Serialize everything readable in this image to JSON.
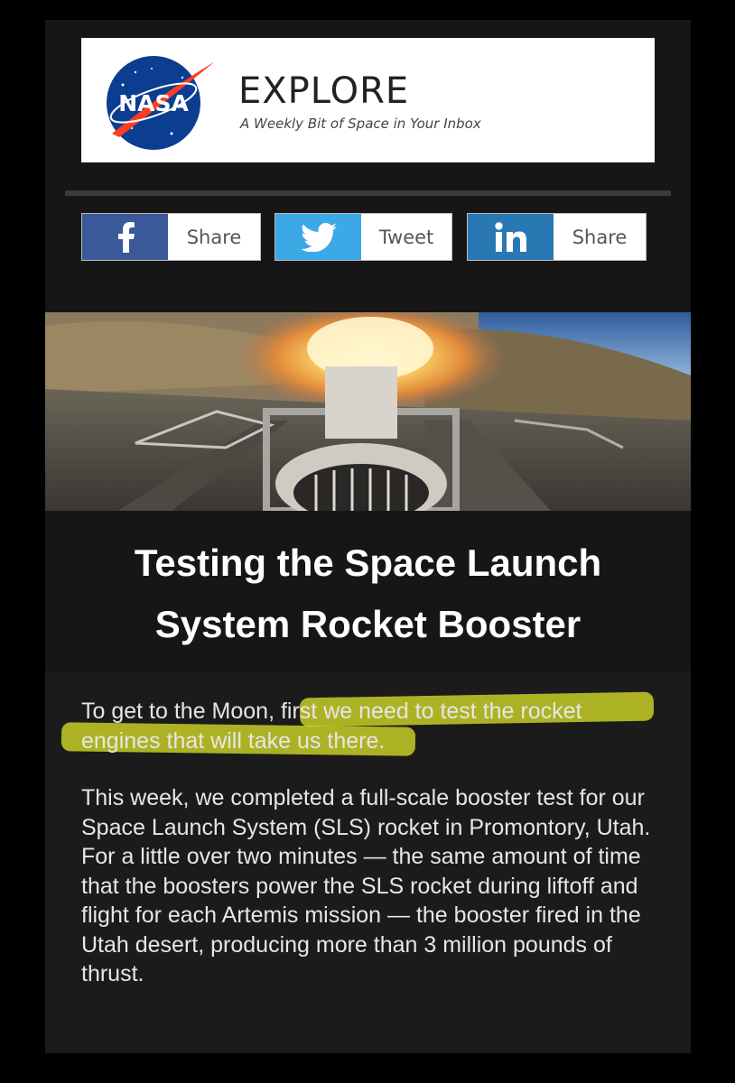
{
  "header": {
    "logo_text": "NASA",
    "title": "EXPLORE",
    "tagline": "A Weekly Bit of Space in Your Inbox"
  },
  "share_buttons": [
    {
      "network": "facebook",
      "icon": "facebook-icon",
      "label": "Share",
      "color": "#3b5998"
    },
    {
      "network": "twitter",
      "icon": "twitter-icon",
      "label": "Tweet",
      "color": "#3aa9e6"
    },
    {
      "network": "linkedin",
      "icon": "linkedin-icon",
      "label": "Share",
      "color": "#2a78b3"
    }
  ],
  "article": {
    "headline_line1": "Testing the Space Launch",
    "headline_line2": "System Rocket Booster",
    "intro_plain": "To get to the Moon, ",
    "intro_highlight_line1": "first we need to test the rocket",
    "intro_highlight_line2": "engines that will take us there",
    "intro_end": ".",
    "paragraph": "This week, we completed a full-scale booster test for our Space Launch System (SLS) rocket in Promontory, Utah. For a little over two minutes — the same amount of time that the boosters power the SLS rocket during liftoff and flight for each Artemis mission — the booster fired in the Utah desert, producing more than 3 million pounds of thrust."
  },
  "colors": {
    "highlight": "#d6dc28",
    "background": "#161616"
  }
}
